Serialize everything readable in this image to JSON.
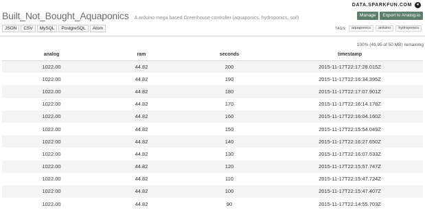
{
  "brand": {
    "name": "DATA.SPARKFUN.COM",
    "icon": "github-icon"
  },
  "stream": {
    "title": "Built_Not_Bought_Aquaponics",
    "description": "A arduino mega based Greenhouse controller (aquaponics, hydroponics, soil)"
  },
  "actions": {
    "manage": "Manage",
    "export": "Export to Analog.io"
  },
  "formats": [
    "JSON",
    "CSV",
    "MySQL",
    "PostgreSQL",
    "Atom"
  ],
  "tags": {
    "label": "TAGS",
    "items": [
      "aquaponics",
      "arduino",
      "hydroponics"
    ]
  },
  "storage": "100% (49.95 of 50 MB) remaining",
  "table": {
    "columns": [
      "analog",
      "ram",
      "seconds",
      "timestamp"
    ],
    "rows": [
      [
        "1022.00",
        "44.82",
        "200",
        "2015-11-17T22:17:28.015Z"
      ],
      [
        "1022.00",
        "44.82",
        "190",
        "2015-11-17T22:16:34.395Z"
      ],
      [
        "1022.00",
        "44.82",
        "180",
        "2015-11-17T22:17:07.901Z"
      ],
      [
        "1022.00",
        "44.82",
        "170",
        "2015-11-17T22:16:14.178Z"
      ],
      [
        "1022.00",
        "44.82",
        "160",
        "2015-11-17T22:16:04.160Z"
      ],
      [
        "1022.00",
        "44.82",
        "150",
        "2015-11-17T22:15:54.049Z"
      ],
      [
        "1022.00",
        "44.82",
        "140",
        "2015-11-17T22:16:27.650Z"
      ],
      [
        "1022.00",
        "44.82",
        "130",
        "2015-11-17T22:16:07.533Z"
      ],
      [
        "1022.00",
        "44.82",
        "120",
        "2015-11-17T22:15:57.747Z"
      ],
      [
        "1022.00",
        "44.82",
        "110",
        "2015-11-17T22:15:47.724Z"
      ],
      [
        "1022.00",
        "44.82",
        "100",
        "2015-11-17T22:15:47.407Z"
      ],
      [
        "1022.00",
        "44.82",
        "90",
        "2015-11-17T22:14:55.703Z"
      ]
    ]
  }
}
